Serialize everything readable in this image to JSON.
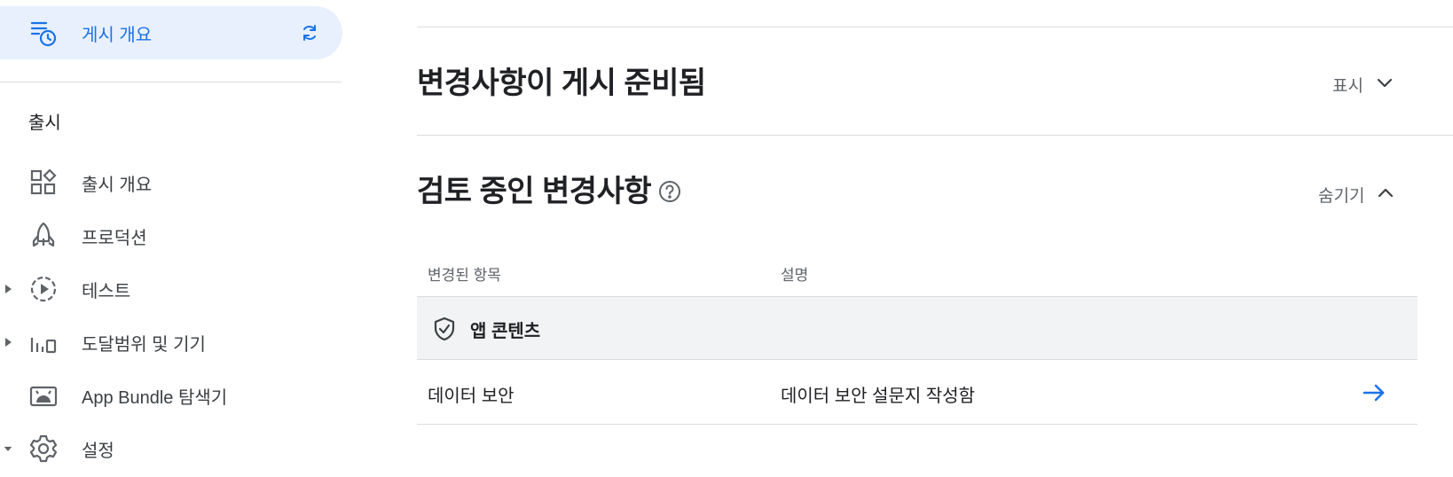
{
  "sidebar": {
    "active_item": {
      "label": "게시 개요",
      "icon": "publishing-overview-icon",
      "sync_icon": "sync-icon"
    },
    "section_heading": "출시",
    "items": [
      {
        "label": "출시 개요",
        "icon": "dashboard-icon",
        "caret": ""
      },
      {
        "label": "프로덕션",
        "icon": "rocket-icon",
        "caret": ""
      },
      {
        "label": "테스트",
        "icon": "play-circle-dashed-icon",
        "caret": "right"
      },
      {
        "label": "도달범위 및 기기",
        "icon": "bar-chart-device-icon",
        "caret": "right"
      },
      {
        "label": "App Bundle 탐색기",
        "icon": "android-icon",
        "caret": ""
      },
      {
        "label": "설정",
        "icon": "gear-icon",
        "caret": "down"
      }
    ]
  },
  "main": {
    "ready_section": {
      "title": "변경사항이 게시 준비됨",
      "toggle_label": "표시",
      "toggle_icon": "chevron-down-icon"
    },
    "review_section": {
      "title": "검토 중인 변경사항",
      "help_icon": "help-icon",
      "toggle_label": "숨기기",
      "toggle_icon": "chevron-up-icon",
      "table": {
        "columns": [
          "변경된 항목",
          "설명"
        ],
        "groups": [
          {
            "label": "앱 콘텐츠",
            "icon": "shield-check-icon",
            "rows": [
              {
                "item": "데이터 보안",
                "description": "데이터 보안 설문지 작성함",
                "action_icon": "arrow-right-icon"
              }
            ]
          }
        ]
      }
    }
  },
  "colors": {
    "accent": "#1a73e8",
    "active_bg": "#e8f0fe",
    "divider": "#dadce0",
    "group_bg": "#f1f3f4",
    "text": "#202124",
    "secondary_text": "#5f6368"
  }
}
